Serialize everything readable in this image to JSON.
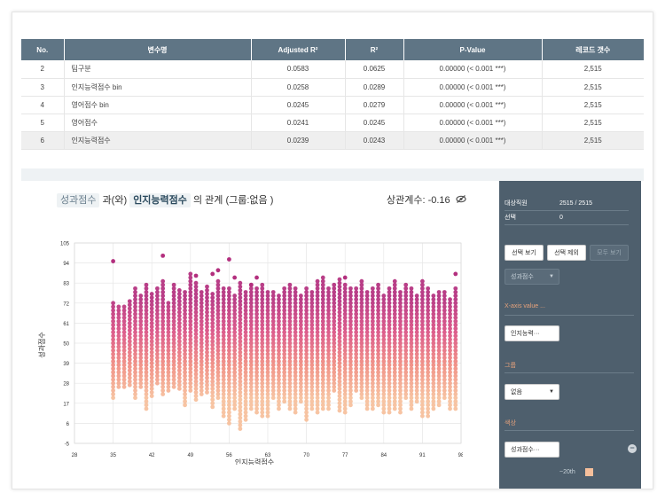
{
  "table": {
    "headers": [
      "No.",
      "변수명",
      "Adjusted R²",
      "R²",
      "P-Value",
      "레코드 갯수"
    ],
    "rows": [
      [
        "2",
        "팀구분",
        "0.0583",
        "0.0625",
        "0.00000 (< 0.001 ***)",
        "2,515"
      ],
      [
        "3",
        "인지능력점수 bin",
        "0.0258",
        "0.0289",
        "0.00000 (< 0.001 ***)",
        "2,515"
      ],
      [
        "4",
        "영어점수 bin",
        "0.0245",
        "0.0279",
        "0.00000 (< 0.001 ***)",
        "2,515"
      ],
      [
        "5",
        "영어점수",
        "0.0241",
        "0.0245",
        "0.00000 (< 0.001 ***)",
        "2,515"
      ],
      [
        "6",
        "인지능력점수",
        "0.0239",
        "0.0243",
        "0.00000 (< 0.001 ***)",
        "2,515"
      ]
    ]
  },
  "chart_title": {
    "var_y": "성과점수",
    "connector": "과(와)",
    "var_x": "인지능력점수",
    "rest": "의 관계 (그룹:없음 )"
  },
  "correlation": {
    "label": "상관계수: -0.16",
    "icon": "eye-off-icon"
  },
  "chart_data": {
    "type": "scatter",
    "xlabel": "인지능력점수",
    "ylabel": "성과점수",
    "xlim": [
      28,
      98
    ],
    "ylim": [
      -5,
      105
    ],
    "x_ticks": [
      28,
      35,
      42,
      49,
      56,
      63,
      70,
      77,
      84,
      91,
      98
    ],
    "y_ticks": [
      -5,
      6,
      17,
      28,
      39,
      50,
      61,
      72,
      83,
      94,
      105
    ],
    "grid": true,
    "color_scale": [
      "#f6bf9b",
      "#f08a80",
      "#d94f83",
      "#b32f7e"
    ],
    "x_values": [
      35,
      36,
      37,
      38,
      39,
      40,
      41,
      42,
      43,
      44,
      45,
      46,
      47,
      48,
      49,
      50,
      51,
      52,
      53,
      54,
      55,
      56,
      57,
      58,
      59,
      60,
      61,
      62,
      63,
      64,
      65,
      66,
      67,
      68,
      69,
      70,
      71,
      72,
      73,
      74,
      75,
      76,
      77,
      78,
      79,
      80,
      81,
      82,
      83,
      84,
      85,
      86,
      87,
      88,
      89,
      90,
      91,
      92,
      93,
      94,
      95,
      96,
      97
    ],
    "column_min": [
      20,
      26,
      26,
      27,
      20,
      26,
      14,
      21,
      28,
      22,
      24,
      26,
      25,
      16,
      24,
      19,
      22,
      23,
      15,
      20,
      10,
      6,
      14,
      3,
      8,
      14,
      12,
      10,
      10,
      20,
      14,
      18,
      14,
      12,
      18,
      8,
      14,
      12,
      14,
      14,
      24,
      13,
      12,
      16,
      24,
      20,
      14,
      14,
      16,
      12,
      12,
      14,
      12,
      20,
      14,
      18,
      10,
      10,
      14,
      16,
      20,
      14,
      14
    ],
    "column_max": [
      72,
      70,
      70,
      74,
      80,
      76,
      82,
      78,
      80,
      85,
      72,
      82,
      80,
      78,
      88,
      84,
      78,
      82,
      78,
      84,
      80,
      80,
      76,
      84,
      78,
      82,
      80,
      82,
      78,
      78,
      76,
      80,
      82,
      80,
      76,
      80,
      78,
      84,
      86,
      80,
      82,
      86,
      82,
      80,
      80,
      84,
      78,
      80,
      82,
      76,
      80,
      84,
      78,
      82,
      80,
      76,
      84,
      80,
      76,
      78,
      78,
      74,
      80
    ],
    "outliers": [
      [
        35,
        95
      ],
      [
        44,
        98
      ],
      [
        50,
        87
      ],
      [
        53,
        88
      ],
      [
        54,
        90
      ],
      [
        56,
        96
      ],
      [
        77,
        86
      ],
      [
        97,
        88
      ],
      [
        57,
        86
      ],
      [
        61,
        86
      ],
      [
        60,
        82
      ]
    ]
  },
  "panel": {
    "rows": [
      {
        "key": "대상직원",
        "value": "2515  / 2515"
      },
      {
        "key": "선택",
        "value": "0"
      }
    ],
    "buttons": {
      "show": "선택 보기",
      "exclude": "선택 제외",
      "show_all": "모두 보기"
    },
    "y_select": "성과점수",
    "x_axis_section": "X-axis value ...",
    "x_select": "인지능력···",
    "group_section": "그룹",
    "group_select": "없음",
    "color_section": "색상",
    "color_select": "성과점수···",
    "legend_label": "~20th",
    "legend_color": "#f6bf9b"
  }
}
